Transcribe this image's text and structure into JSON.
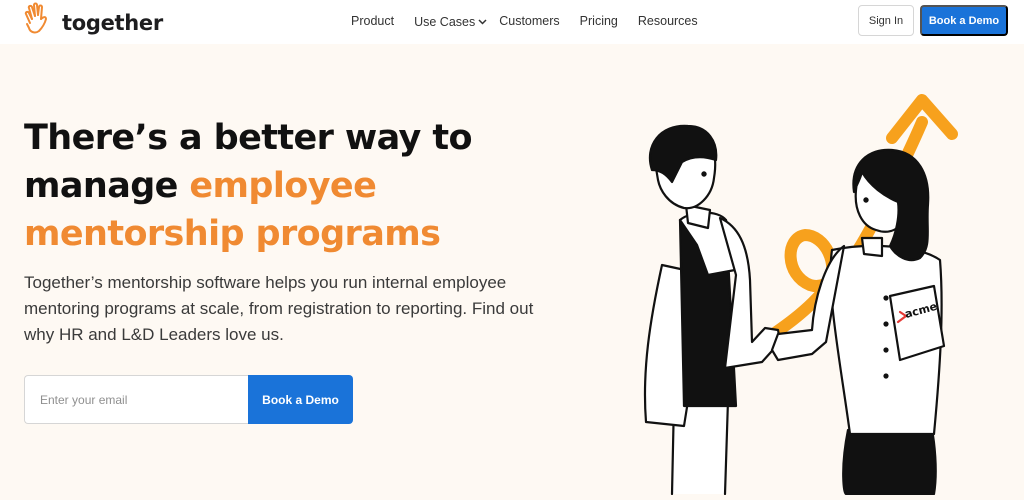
{
  "brand": {
    "name": "together"
  },
  "nav": {
    "links": [
      "Product",
      "Use Cases",
      "Customers",
      "Pricing",
      "Resources"
    ],
    "sign_in": "Sign In",
    "cta": "Book a Demo"
  },
  "hero": {
    "headline_part1": "There’s a better way to",
    "headline_part2": "manage ",
    "headline_highlight1": "employee",
    "headline_highlight2": "mentorship programs",
    "subheadline": "Together’s mentorship software helps you run internal employee mentoring programs at scale, from registration to reporting. Find out why HR and L&D Leaders love us.",
    "email_placeholder": "Enter your email",
    "cta": "Book a Demo"
  },
  "illustration": {
    "badge_text": "acme"
  },
  "colors": {
    "accent_orange": "#f08a32",
    "primary_blue": "#1a73d9",
    "background": "#fef9f3"
  },
  "icons": {
    "logo": "hand-wave-icon",
    "dropdown": "chevron-down-icon"
  }
}
